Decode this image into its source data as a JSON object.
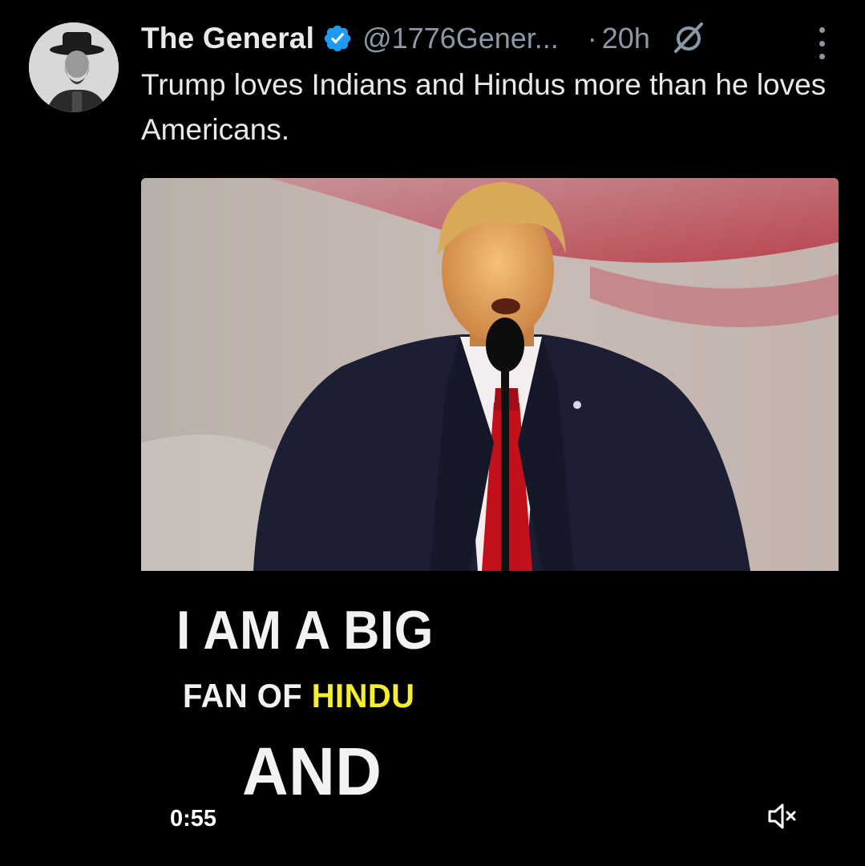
{
  "tweet": {
    "display_name": "The General",
    "handle": "@1776Gener...",
    "dot": "·",
    "time": "20h",
    "text": "Trump loves Indians and Hindus more than he loves Americans."
  },
  "icons": {
    "verified": "verified-badge-icon",
    "grok": "grok-icon",
    "more": "more-options-icon",
    "mute": "muted-speaker-icon"
  },
  "media": {
    "caption_line1": "I AM A BIG",
    "caption_line2_prefix": "FAN OF ",
    "caption_line2_highlight": "HINDU",
    "caption_line3": "AND",
    "duration": "0:55"
  },
  "colors": {
    "accent_blue": "#1d9bf0",
    "caption_highlight": "#f6ee2a",
    "secondary_text": "#8b98a5"
  }
}
